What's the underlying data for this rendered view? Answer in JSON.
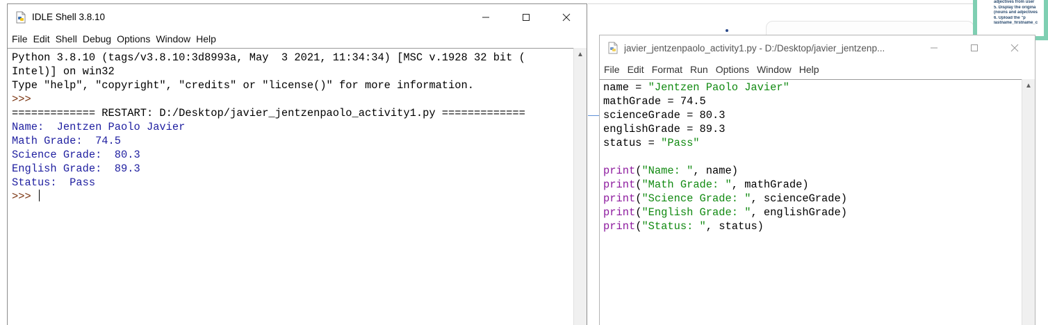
{
  "background_note": {
    "lines": [
      "adjectives from user",
      "5. Display the origina",
      "(nouns and adjectives",
      "6.   Upload   the   \"p",
      "lastname_firstname_c"
    ]
  },
  "shell_window": {
    "title": "IDLE Shell 3.8.10",
    "menu": [
      "File",
      "Edit",
      "Shell",
      "Debug",
      "Options",
      "Window",
      "Help"
    ],
    "lines": [
      {
        "text": "Python 3.8.10 (tags/v3.8.10:3d8993a, May  3 2021, 11:34:34) [MSC v.1928 32 bit (",
        "style": "plain"
      },
      {
        "text": "Intel)] on win32",
        "style": "plain"
      },
      {
        "text": "Type \"help\", \"copyright\", \"credits\" or \"license()\" for more information.",
        "style": "plain"
      },
      {
        "text": ">>> ",
        "style": "prompt"
      },
      {
        "text": "============= RESTART: D:/Desktop/javier_jentzenpaolo_activity1.py =============",
        "style": "plain"
      },
      {
        "text": "Name:  Jentzen Paolo Javier",
        "style": "output"
      },
      {
        "text": "Math Grade:  74.5",
        "style": "output"
      },
      {
        "text": "Science Grade:  80.3",
        "style": "output"
      },
      {
        "text": "English Grade:  89.3",
        "style": "output"
      },
      {
        "text": "Status:  Pass",
        "style": "output"
      }
    ],
    "final_prompt": ">>> "
  },
  "editor_window": {
    "title": "javier_jentzenpaolo_activity1.py - D:/Desktop/javier_jentzenp...",
    "menu": [
      "File",
      "Edit",
      "Format",
      "Run",
      "Options",
      "Window",
      "Help"
    ],
    "code_lines": [
      [
        {
          "t": "name = ",
          "c": "plain"
        },
        {
          "t": "\"Jentzen Paolo Javier\"",
          "c": "str"
        }
      ],
      [
        {
          "t": "mathGrade = 74.5",
          "c": "plain"
        }
      ],
      [
        {
          "t": "scienceGrade = 80.3",
          "c": "plain"
        }
      ],
      [
        {
          "t": "englishGrade = 89.3",
          "c": "plain"
        }
      ],
      [
        {
          "t": "status = ",
          "c": "plain"
        },
        {
          "t": "\"Pass\"",
          "c": "str"
        }
      ],
      [],
      [
        {
          "t": "print",
          "c": "kw"
        },
        {
          "t": "(",
          "c": "plain"
        },
        {
          "t": "\"Name: \"",
          "c": "str"
        },
        {
          "t": ", name)",
          "c": "plain"
        }
      ],
      [
        {
          "t": "print",
          "c": "kw"
        },
        {
          "t": "(",
          "c": "plain"
        },
        {
          "t": "\"Math Grade: \"",
          "c": "str"
        },
        {
          "t": ", mathGrade)",
          "c": "plain"
        }
      ],
      [
        {
          "t": "print",
          "c": "kw"
        },
        {
          "t": "(",
          "c": "plain"
        },
        {
          "t": "\"Science Grade: \"",
          "c": "str"
        },
        {
          "t": ", scienceGrade)",
          "c": "plain"
        }
      ],
      [
        {
          "t": "print",
          "c": "kw"
        },
        {
          "t": "(",
          "c": "plain"
        },
        {
          "t": "\"English Grade: \"",
          "c": "str"
        },
        {
          "t": ", englishGrade)",
          "c": "plain"
        }
      ],
      [
        {
          "t": "print",
          "c": "kw"
        },
        {
          "t": "(",
          "c": "plain"
        },
        {
          "t": "\"Status: \"",
          "c": "str"
        },
        {
          "t": ", status)",
          "c": "plain"
        }
      ]
    ]
  },
  "icons": {
    "app": "python-file-icon",
    "minimize": "minimize-icon",
    "maximize": "maximize-icon",
    "close": "close-icon",
    "scroll_up": "scroll-up-arrow-icon"
  },
  "colors": {
    "keyword": "#8d1a9e",
    "string": "#118a11",
    "output": "#1f1fa0",
    "prompt": "#7a3410"
  }
}
